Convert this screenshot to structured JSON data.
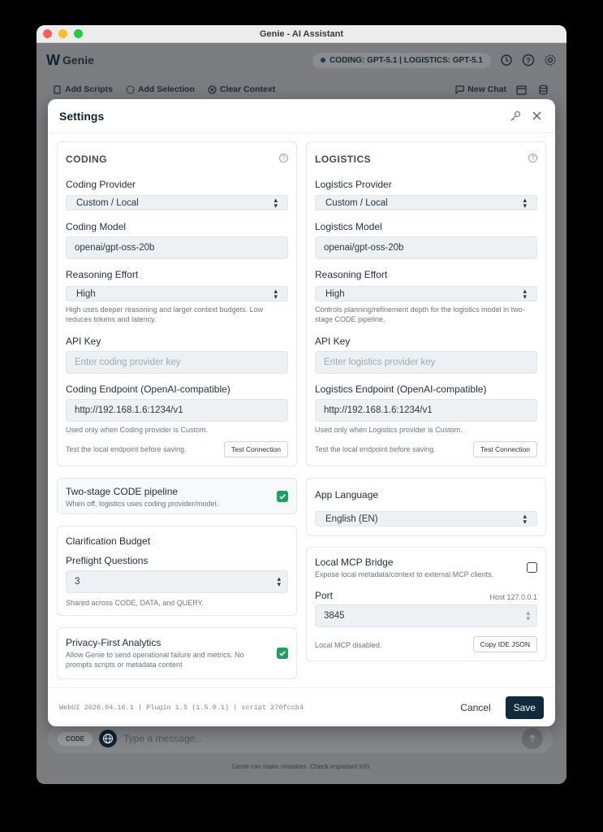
{
  "window": {
    "title": "Genie - AI Assistant"
  },
  "appbar": {
    "brand": "Genie",
    "model_status": "CODING: GPT-5.1 | LOGISTICS: GPT-5.1"
  },
  "toolbar": {
    "add_scripts": "Add Scripts",
    "add_selection": "Add Selection",
    "clear_context": "Clear Context",
    "new_chat": "New Chat"
  },
  "composer": {
    "mode": "CODE",
    "placeholder": "Type a message...",
    "disclaimer": "Genie can make mistakes. Check important info."
  },
  "settings": {
    "title": "Settings",
    "coding": {
      "heading": "CODING",
      "provider_label": "Coding Provider",
      "provider_value": "Custom / Local",
      "model_label": "Coding Model",
      "model_value": "openai/gpt-oss-20b",
      "reasoning_label": "Reasoning Effort",
      "reasoning_value": "High",
      "reasoning_hint": "High uses deeper reasoning and larger context budgets. Low reduces tokens and latency.",
      "api_key_label": "API Key",
      "api_key_placeholder": "Enter coding provider key",
      "endpoint_label": "Coding Endpoint (OpenAI-compatible)",
      "endpoint_value": "http://192.168.1.6:1234/v1",
      "endpoint_hint": "Used only when Coding provider is Custom.",
      "test_hint": "Test the local endpoint before saving.",
      "test_button": "Test Connection"
    },
    "logistics": {
      "heading": "LOGISTICS",
      "provider_label": "Logistics Provider",
      "provider_value": "Custom / Local",
      "model_label": "Logistics Model",
      "model_value": "openai/gpt-oss-20b",
      "reasoning_label": "Reasoning Effort",
      "reasoning_value": "High",
      "reasoning_hint": "Controls planning/refinement depth for the logistics model in two-stage CODE pipeline.",
      "api_key_label": "API Key",
      "api_key_placeholder": "Enter logistics provider key",
      "endpoint_label": "Logistics Endpoint (OpenAI-compatible)",
      "endpoint_value": "http://192.168.1.6:1234/v1",
      "endpoint_hint": "Used only when Logistics provider is Custom.",
      "test_hint": "Test the local endpoint before saving.",
      "test_button": "Test Connection"
    },
    "pipeline": {
      "title": "Two-stage CODE pipeline",
      "subtitle": "When off, logistics uses coding provider/model.",
      "checked": true
    },
    "clarification": {
      "title": "Clarification Budget",
      "questions_label": "Preflight Questions",
      "questions_value": "3",
      "hint": "Shared across CODE, DATA, and QUERY."
    },
    "privacy": {
      "title": "Privacy-First Analytics",
      "subtitle": "Allow Genie to send operational failure and metrics. No prompts scripts or metadata content",
      "checked": true
    },
    "language": {
      "title": "App Language",
      "value": "English (EN)"
    },
    "mcp": {
      "title": "Local MCP Bridge",
      "subtitle": "Expose local metadata/context to external MCP clients.",
      "checked": false,
      "port_label": "Port",
      "host_label": "Host 127.0.0.1",
      "port_value": "3845",
      "status": "Local MCP disabled.",
      "copy_button": "Copy IDE JSON"
    },
    "footer": {
      "version": "WebUI 2026.04.16.1 | Plugin 1.5 (1.5.0.1) | script 270fccb4",
      "cancel": "Cancel",
      "save": "Save"
    }
  },
  "colors": {
    "accent": "#0f2a3a",
    "checkbox": "#1fa060",
    "modal_bg": "#ffffff",
    "overlay": "#7b7d80"
  }
}
